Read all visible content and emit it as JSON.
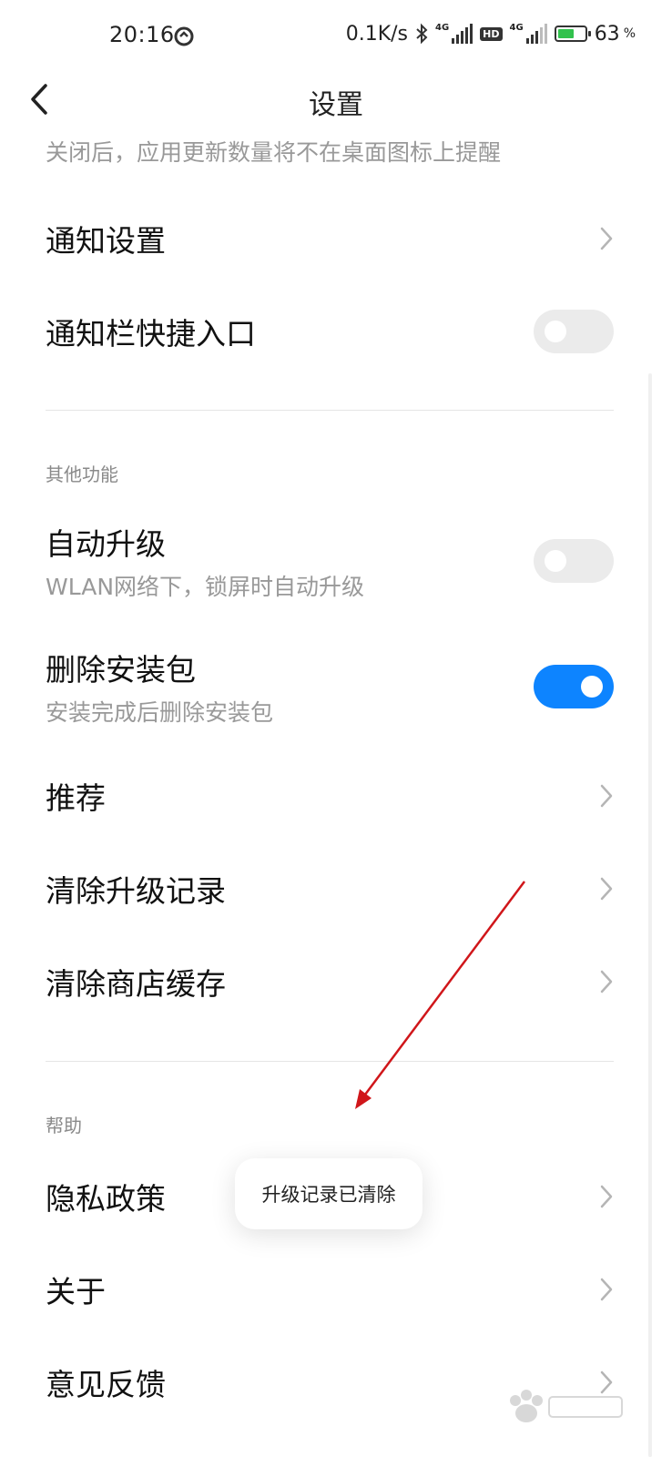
{
  "status_bar": {
    "time": "20:16",
    "net_speed": "0.1K/s",
    "network1": "4G",
    "hd": "HD",
    "network2": "4G",
    "battery_pct": "63",
    "battery_unit": "%",
    "battery_level": 0.63,
    "icons": [
      "sync-icon",
      "bluetooth-icon",
      "signal-icon",
      "hd-icon",
      "signal-icon",
      "battery-charging-icon"
    ]
  },
  "header": {
    "title": "设置"
  },
  "top_note": "关闭后，应用更新数量将不在桌面图标上提醒",
  "items": {
    "notify_settings": {
      "label": "通知设置"
    },
    "notify_shortcut": {
      "label": "通知栏快捷入口",
      "enabled": false
    },
    "auto_upgrade": {
      "label": "自动升级",
      "sub": "WLAN网络下，锁屏时自动升级",
      "enabled": false
    },
    "delete_package": {
      "label": "删除安装包",
      "sub": "安装完成后删除安装包",
      "enabled": true
    },
    "recommend": {
      "label": "推荐"
    },
    "clear_upgrade": {
      "label": "清除升级记录"
    },
    "clear_cache": {
      "label": "清除商店缓存"
    },
    "privacy": {
      "label": "隐私政策"
    },
    "about": {
      "label": "关于"
    },
    "feedback": {
      "label": "意见反馈"
    }
  },
  "sections": {
    "other": "其他功能",
    "help": "帮助"
  },
  "toast": "升级记录已清除",
  "colors": {
    "toggle_on": "#0d84ff",
    "toggle_off": "#ebebeb",
    "annotation_arrow": "#d0161a",
    "battery": "#32c24d"
  }
}
